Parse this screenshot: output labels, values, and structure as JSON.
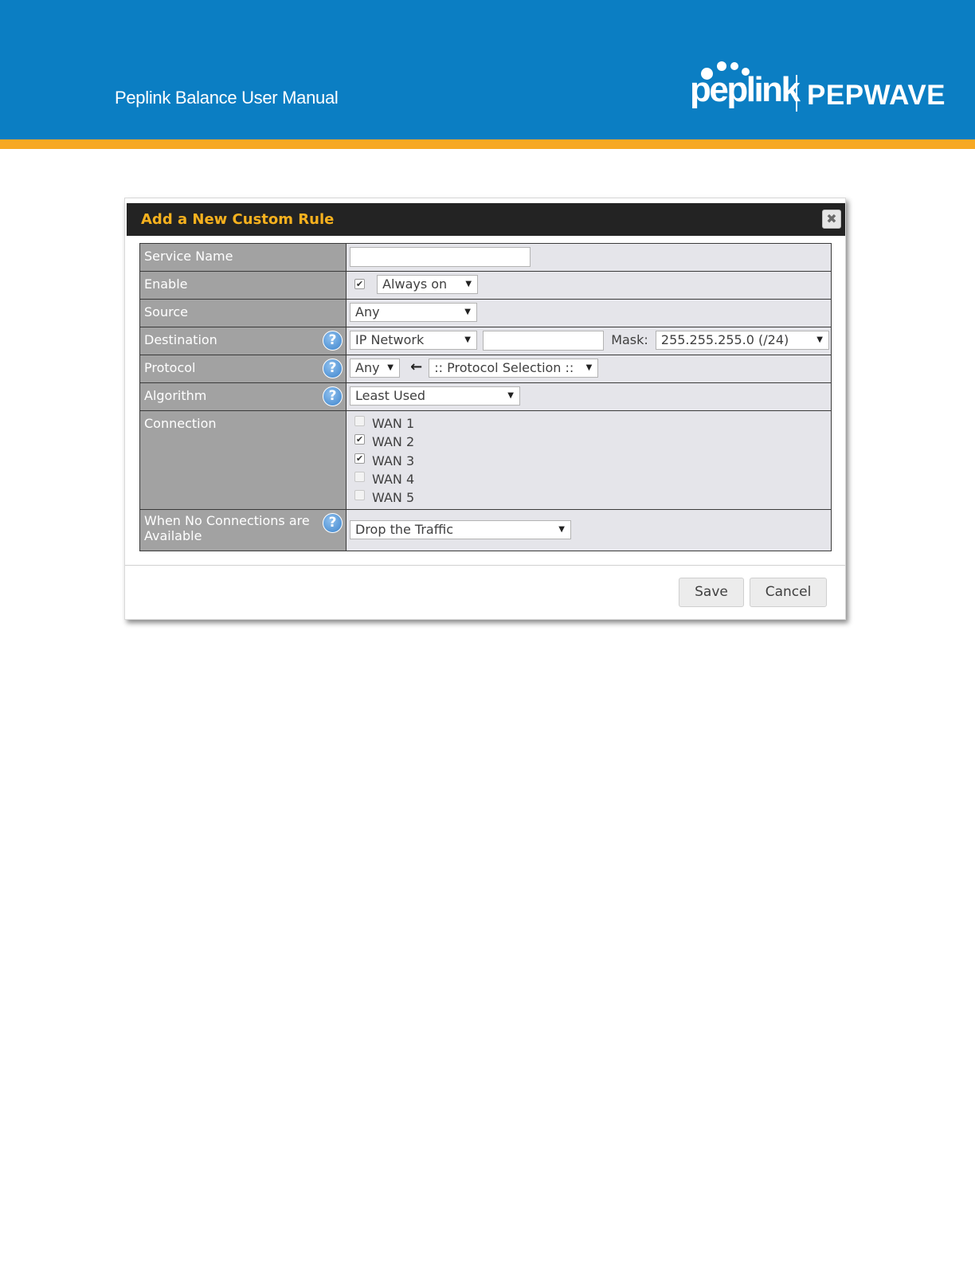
{
  "header": {
    "manual_title": "Peplink Balance User Manual",
    "logo_left": "peplink",
    "logo_right": "PEPWAVE",
    "colors": {
      "banner": "#0b7ec3",
      "stripe": "#f7a823"
    }
  },
  "dialog": {
    "title": "Add a New Custom Rule",
    "close_icon": "close-icon",
    "rows": {
      "service_name": {
        "label": "Service Name",
        "value": ""
      },
      "enable": {
        "label": "Enable",
        "checked": true,
        "schedule": "Always on"
      },
      "source": {
        "label": "Source",
        "value": "Any"
      },
      "destination": {
        "label": "Destination",
        "type": "IP Network",
        "address": "",
        "mask_label": "Mask:",
        "mask": "255.255.255.0 (/24)"
      },
      "protocol": {
        "label": "Protocol",
        "value": "Any",
        "selection": ":: Protocol Selection ::"
      },
      "algorithm": {
        "label": "Algorithm",
        "value": "Least Used"
      },
      "connection": {
        "label": "Connection",
        "wans": [
          {
            "label": "WAN 1",
            "checked": false
          },
          {
            "label": "WAN 2",
            "checked": true
          },
          {
            "label": "WAN 3",
            "checked": true
          },
          {
            "label": "WAN 4",
            "checked": false
          },
          {
            "label": "WAN 5",
            "checked": false
          }
        ]
      },
      "no_connections": {
        "label_line1": "When No Connections are",
        "label_line2": "Available",
        "value": "Drop the Traffic"
      }
    },
    "buttons": {
      "save": "Save",
      "cancel": "Cancel"
    },
    "colors": {
      "title": "#f6b11e",
      "header_bg": "#232323",
      "label_bg": "#a2a2a2",
      "value_bg": "#e5e5ea"
    }
  }
}
